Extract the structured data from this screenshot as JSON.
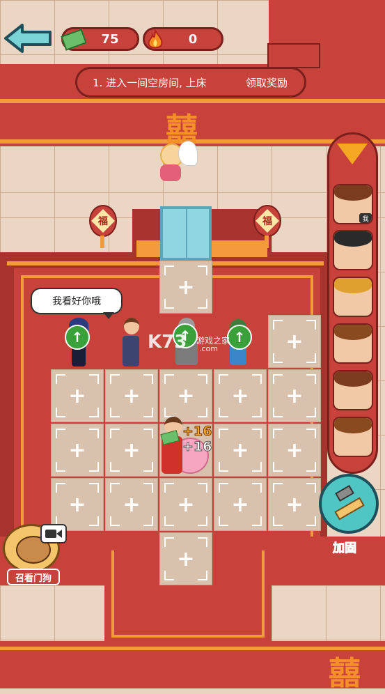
{
  "hud": {
    "money": "75",
    "fire": "0",
    "money_icon": "cash-icon",
    "fire_icon": "fire-icon"
  },
  "task": {
    "text": "1. 进入一间空房间, 上床",
    "reward_label": "领取奖励"
  },
  "decor": {
    "double_happiness": "囍",
    "lantern_char": "福"
  },
  "speech_bubble": "我看好你哦",
  "score_popups": [
    "+16",
    "+16"
  ],
  "watermark": {
    "brand": "K73",
    "sub": "游戏之家",
    "domain": ".com"
  },
  "reinforce_label": "加固",
  "summon_dog_label": "召看门狗",
  "avatar_badge": "我",
  "colors": {
    "red": "#c8423c",
    "orange": "#f39a3a",
    "dark_red": "#7a1f1c",
    "floor": "#ead6c2"
  }
}
